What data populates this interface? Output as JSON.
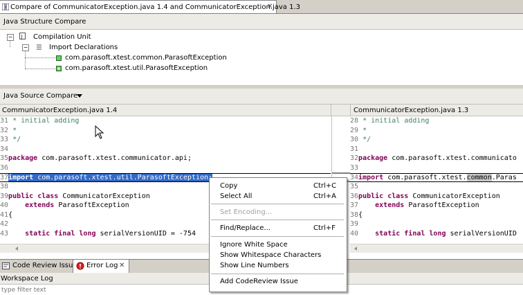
{
  "title_tab": {
    "label": "Compare of CommunicatorException.java 1.4 and CommunicatorException.java 1.3"
  },
  "structure_compare": {
    "title": "Java Structure Compare",
    "tree": {
      "root": "Compilation Unit",
      "child": "Import Declarations",
      "leaves": [
        "com.parasoft.xtest.common.ParasoftException",
        "com.parasoft.xtest.util.ParasoftException"
      ]
    }
  },
  "source_compare": {
    "title": "Java Source Compare",
    "left": {
      "file": "CommunicatorException.java 1.4",
      "lines": [
        {
          "n": "31",
          "t": " * initial adding"
        },
        {
          "n": "32",
          "t": " *"
        },
        {
          "n": "33",
          "t": " */"
        },
        {
          "n": "34",
          "t": ""
        },
        {
          "n": "35",
          "t": "package com.parasoft.xtest.communicator.api;"
        },
        {
          "n": "36",
          "t": ""
        },
        {
          "n": "37",
          "t": "import com.parasoft.xtest.util.ParasoftException;"
        },
        {
          "n": "38",
          "t": ""
        },
        {
          "n": "39",
          "t": "public class CommunicatorException"
        },
        {
          "n": "40",
          "t": "    extends ParasoftException"
        },
        {
          "n": "41",
          "t": "{"
        },
        {
          "n": "42",
          "t": ""
        },
        {
          "n": "43",
          "t": "    static final long serialVersionUID = -754"
        }
      ]
    },
    "right": {
      "file": "CommunicatorException.java 1.3",
      "lines": [
        {
          "n": "28",
          "t": " * initial adding"
        },
        {
          "n": "29",
          "t": " *"
        },
        {
          "n": "30",
          "t": " */"
        },
        {
          "n": "31",
          "t": ""
        },
        {
          "n": "32",
          "t": "package com.parasoft.xtest.communicato"
        },
        {
          "n": "33",
          "t": ""
        },
        {
          "n": "34",
          "t": "import com.parasoft.xtest.common.Paras"
        },
        {
          "n": "35",
          "t": ""
        },
        {
          "n": "36",
          "t": "public class CommunicatorException"
        },
        {
          "n": "37",
          "t": "    extends ParasoftException"
        },
        {
          "n": "38",
          "t": "{"
        },
        {
          "n": "39",
          "t": ""
        },
        {
          "n": "40",
          "t": "    static final long serialVersionUID"
        }
      ]
    }
  },
  "bottom_tabs": [
    {
      "label": "Code Review Issue"
    },
    {
      "label": "Error Log"
    }
  ],
  "workspace_log": {
    "title": "Workspace Log",
    "filter_placeholder": "type filter text"
  },
  "context_menu": {
    "copy": {
      "label": "Copy",
      "shortcut": "Ctrl+C"
    },
    "select_all": {
      "label": "Select All",
      "shortcut": "Ctrl+A"
    },
    "set_encoding": {
      "label": "Set Encoding..."
    },
    "find_replace": {
      "label": "Find/Replace...",
      "shortcut": "Ctrl+F"
    },
    "ignore_ws": {
      "label": "Ignore White Space"
    },
    "show_ws": {
      "label": "Show Whitespace Characters"
    },
    "show_ln": {
      "label": "Show Line Numbers"
    },
    "add_issue": {
      "label": "Add CodeReview Issue"
    }
  },
  "colors": {
    "selection": "#3169c6",
    "keyword": "#7f0055",
    "comment": "#3f7f5f"
  },
  "icons": [
    "compare-icon",
    "close-icon",
    "expand-icon",
    "java-file-icon",
    "imports-icon",
    "import-icon",
    "dropdown-arrow-icon",
    "review-icon",
    "error-log-icon",
    "mouse-cursor-icon"
  ]
}
